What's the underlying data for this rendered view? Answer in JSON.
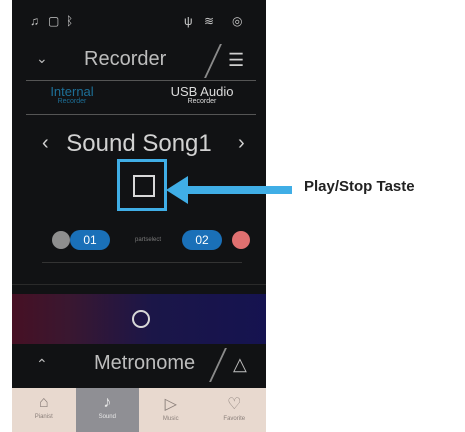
{
  "colors": {
    "accent": "#40aee6",
    "part_blue": "#1a70b8",
    "active_tab": "#1d6f97",
    "part_red": "#e07070",
    "part_gray": "#8e8e8e"
  },
  "status_bar": {
    "icons": [
      "headphones-icon",
      "lock-icon",
      "bluetooth-icon",
      "usb-icon",
      "wifi-icon",
      "broadcast-icon"
    ]
  },
  "recorder": {
    "title": "Recorder",
    "tabs": [
      {
        "label": "Internal",
        "sub": "Recorder",
        "active": true
      },
      {
        "label": "USB Audio",
        "sub": "Recorder",
        "active": false
      }
    ],
    "song_name": "Sound Song1",
    "part_select_label": "partselect",
    "parts": [
      "01",
      "02"
    ],
    "record_button_icon": "circle-icon"
  },
  "metronome": {
    "label": "Metronome"
  },
  "bottom_nav": [
    {
      "label": "Pianist",
      "icon": "piano-icon"
    },
    {
      "label": "Sound",
      "icon": "note-icon"
    },
    {
      "label": "Music",
      "icon": "play-icon"
    },
    {
      "label": "Favorite",
      "icon": "heart-icon"
    }
  ],
  "callout": {
    "label": "Play/Stop Taste"
  }
}
